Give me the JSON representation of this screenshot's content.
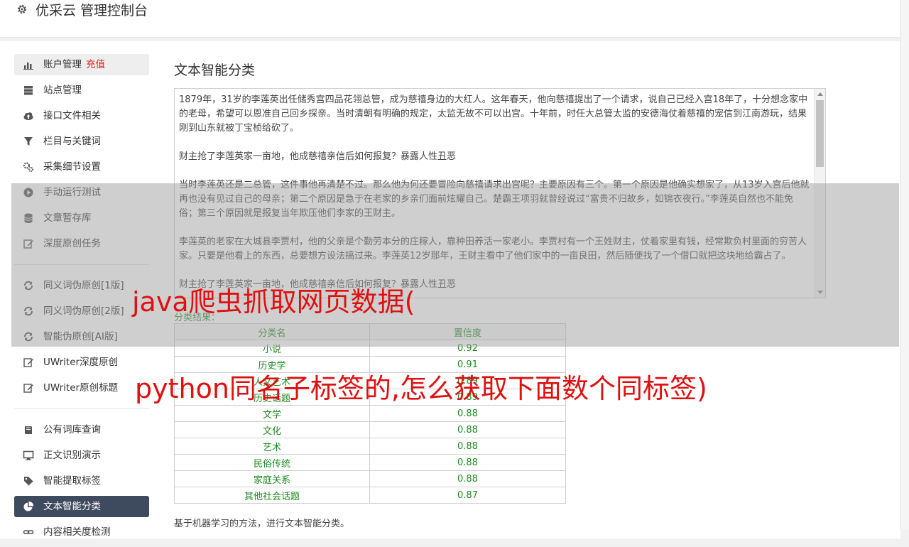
{
  "header": {
    "title": "优采云 管理控制台",
    "icon": "gear-icon"
  },
  "sidebar": {
    "groups": [
      [
        {
          "label": "账户管理",
          "badge": "充值",
          "icon": "bar-chart-icon",
          "state": "hover"
        },
        {
          "label": "站点管理",
          "icon": "server-icon"
        },
        {
          "label": "接口文件相关",
          "icon": "cloud-upload-icon"
        },
        {
          "label": "栏目与关键词",
          "icon": "filter-icon"
        },
        {
          "label": "采集细节设置",
          "icon": "cogs-icon"
        },
        {
          "label": "手动运行测试",
          "icon": "play-icon"
        },
        {
          "label": "文章暂存库",
          "icon": "database-icon"
        },
        {
          "label": "深度原创任务",
          "icon": "edit-icon"
        }
      ],
      [
        {
          "label": "同义词伪原创[1版]",
          "icon": "refresh-icon"
        },
        {
          "label": "同义词伪原创[2版]",
          "icon": "refresh-icon"
        },
        {
          "label": "智能伪原创[AI版]",
          "icon": "refresh-icon"
        },
        {
          "label": "UWriter深度原创",
          "icon": "edit-icon"
        },
        {
          "label": "UWriter原创标题",
          "icon": "edit-icon"
        }
      ],
      [
        {
          "label": "公有词库查询",
          "icon": "book-icon"
        },
        {
          "label": "正文识别演示",
          "icon": "monitor-icon"
        },
        {
          "label": "智能提取标签",
          "icon": "tag-icon"
        },
        {
          "label": "文本智能分类",
          "icon": "pie-chart-icon",
          "state": "active"
        },
        {
          "label": "内容相关度检测",
          "icon": "link-icon"
        }
      ]
    ]
  },
  "content": {
    "title": "文本智能分类",
    "text_paragraphs": [
      "1879年，31岁的李莲英出任储秀宫四品花翎总管，成为慈禧身边的大红人。这年春天，他向慈禧提出了一个请求，说自己已经入宫18年了，十分想念家中的老母，希望可以恩准自己回乡探亲。当时清朝有明确的规定，太监无故不可以出宫。十年前，时任大总管太监的安德海仗着慈禧的宠信到江南游玩，结果刚到山东就被丁宝桢给砍了。",
      "财主抢了李莲英家一亩地，他成慈禧亲信后如何报复？暴露人性丑恶",
      "当时李莲英还是二总管，这件事他再清楚不过。那么他为何还要冒险向慈禧请求出宫呢？主要原因有三个。第一个原因是他确实想家了，从13岁入宫后他就再也没有见过自己的母亲；第二个原因是急于在老家的乡亲们面前炫耀自己。楚霸王项羽就曾经说过“富贵不归故乡，如锦衣夜行。”李莲英自然也不能免俗；第三个原因就是报复当年欺压他们李家的王财主。",
      "李莲英的老家在大城县李贾村，他的父亲是个勤劳本分的庄稼人，靠种田养活一家老小。李贾村有一个王姓财主，仗着家里有钱，经常欺负村里面的穷苦人家。只要是他看上的东西，总要想方设法搞过来。李莲英12岁那年，王财主看中了他们家中的一亩良田，然后随便找了一个借口就把这块地给霸占了。",
      "财主抢了李莲英家一亩地，他成慈禧亲信后如何报复？暴露人性丑恶"
    ],
    "result_label": "分类结果：",
    "table": {
      "headers": [
        "分类名",
        "置信度"
      ],
      "rows": [
        [
          "小说",
          "0.92"
        ],
        [
          "历史学",
          "0.91"
        ],
        [
          "人文艺术",
          "0.89"
        ],
        [
          "历史话题",
          "0.89"
        ],
        [
          "文学",
          "0.88"
        ],
        [
          "文化",
          "0.88"
        ],
        [
          "艺术",
          "0.88"
        ],
        [
          "民俗传统",
          "0.88"
        ],
        [
          "家庭关系",
          "0.88"
        ],
        [
          "其他社会话题",
          "0.87"
        ]
      ]
    },
    "footer_note": "基于机器学习的方法，进行文本智能分类。"
  },
  "overlay": {
    "line1": "java爬虫抓取网页数据(",
    "line2": "python同名子标签的,怎么获取下面数个同标签)"
  },
  "colors": {
    "active_bg": "#3e4a5e",
    "result_green": "#1e8a1e",
    "overlay_red": "#e01010",
    "badge_red": "#e02020"
  }
}
